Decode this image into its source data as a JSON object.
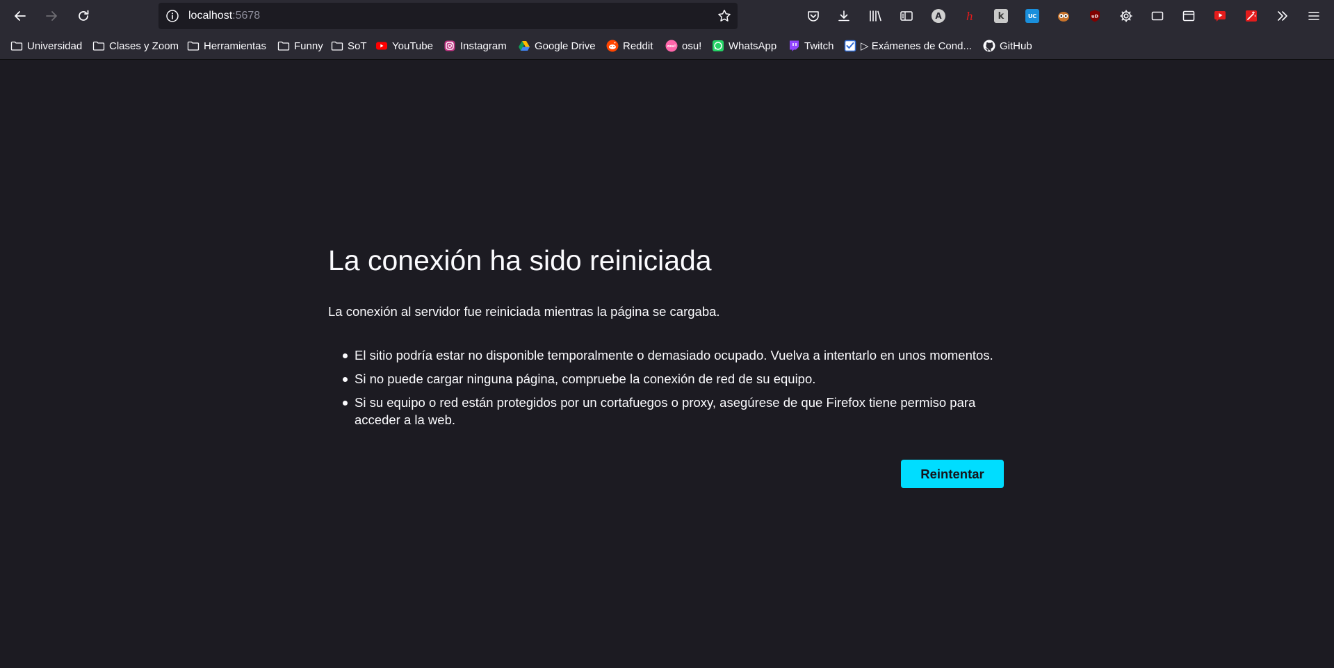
{
  "browser": {
    "url": {
      "host": "localhost",
      "port": ":5678"
    },
    "bookmarks": [
      {
        "label": "Universidad",
        "icon": "folder-icon"
      },
      {
        "label": "Clases y Zoom",
        "icon": "folder-icon"
      },
      {
        "label": "Herramientas",
        "icon": "folder-icon"
      },
      {
        "label": "Funny",
        "icon": "folder-icon"
      },
      {
        "label": "SoT",
        "icon": "folder-icon"
      },
      {
        "label": "YouTube",
        "icon": "youtube-icon"
      },
      {
        "label": "Instagram",
        "icon": "instagram-icon"
      },
      {
        "label": "Google Drive",
        "icon": "google-drive-icon"
      },
      {
        "label": "Reddit",
        "icon": "reddit-icon"
      },
      {
        "label": "osu!",
        "icon": "osu-icon"
      },
      {
        "label": "WhatsApp",
        "icon": "whatsapp-icon"
      },
      {
        "label": "Twitch",
        "icon": "twitch-icon"
      },
      {
        "label": "▷ Exámenes de Cond...",
        "icon": "checkbox-icon"
      },
      {
        "label": "GitHub",
        "icon": "github-icon"
      }
    ],
    "extensions": {
      "a_letter": "A",
      "h_letter": "h",
      "k_letter": "k",
      "uc_label": "UC",
      "ublock_label": "uD"
    },
    "colors": {
      "accent": "#00ddff",
      "toolbar": "#2b2a33",
      "page_background": "#1c1b22",
      "text": "#fbfbfe"
    }
  },
  "error_page": {
    "title": "La conexión ha sido reiniciada",
    "description": "La conexión al servidor fue reiniciada mientras la página se cargaba.",
    "tips": [
      "El sitio podría estar no disponible temporalmente o demasiado ocupado. Vuelva a intentarlo en unos momentos.",
      "Si no puede cargar ninguna página, compruebe la conexión de red de su equipo.",
      "Si su equipo o red están protegidos por un cortafuegos o proxy, asegúrese de que Firefox tiene permiso para acceder a la web."
    ],
    "retry_label": "Reintentar"
  }
}
